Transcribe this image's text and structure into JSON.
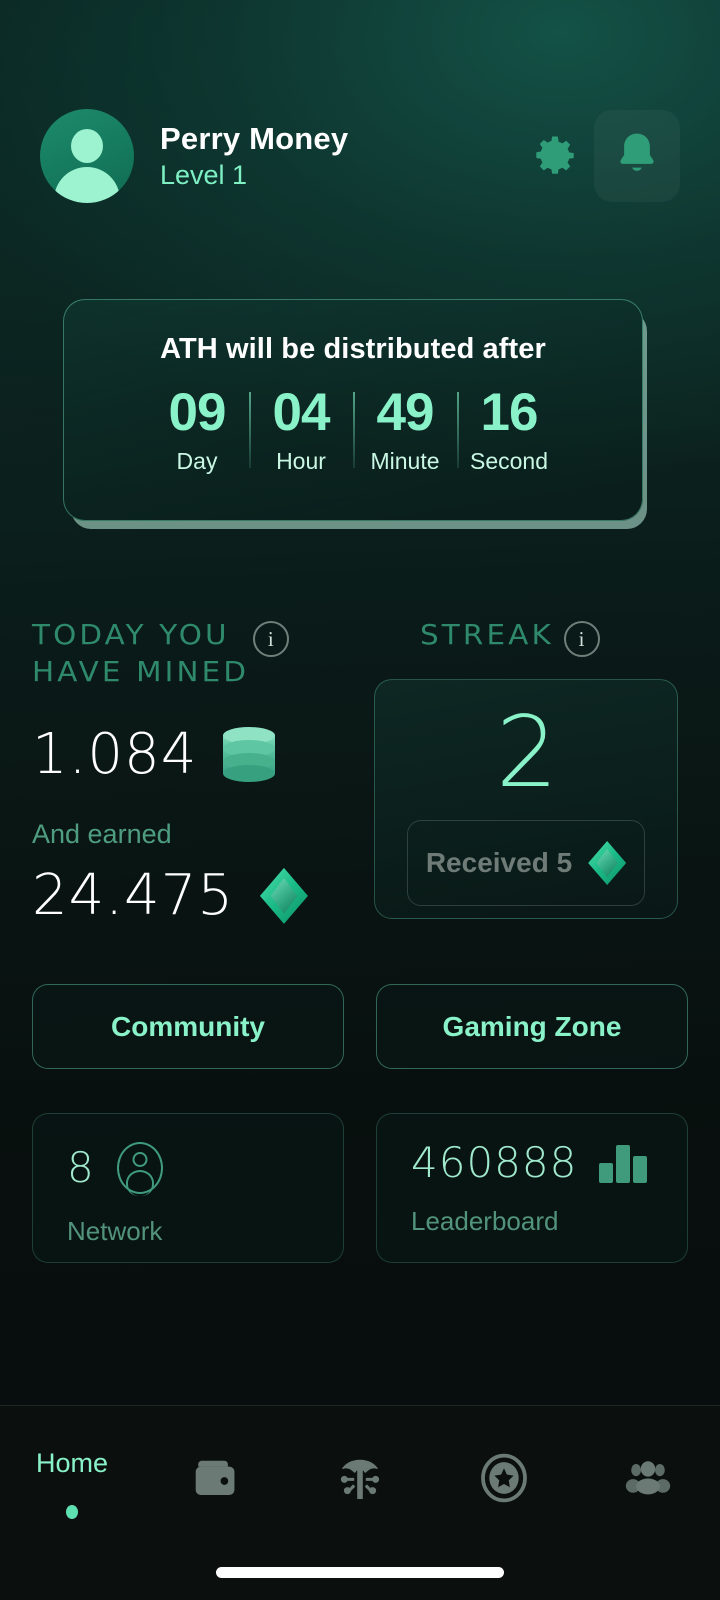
{
  "header": {
    "avatar_name": "avatar",
    "username": "Perry Money",
    "level": "Level 1",
    "gear_icon": "gear-icon",
    "bell_icon": "bell-icon"
  },
  "countdown": {
    "title": "ATH will be distributed after",
    "segments": [
      {
        "value": "09",
        "label": "Day"
      },
      {
        "value": "04",
        "label": "Hour"
      },
      {
        "value": "49",
        "label": "Minute"
      },
      {
        "value": "16",
        "label": "Second"
      }
    ]
  },
  "mined": {
    "heading_line1": "TODAY YOU",
    "heading_line2": "HAVE MINED",
    "info_icon": "i",
    "amount": "1.084",
    "coin_icon": "coin-stack-icon",
    "earned_label": "And earned",
    "earned_amount": "24.475",
    "gem_icon": "gem-icon"
  },
  "streak": {
    "heading": "STREAK",
    "info_icon": "i",
    "count": "2",
    "received_label": "Received 5",
    "gem_icon": "gem-icon"
  },
  "actions": [
    {
      "label": "Community"
    },
    {
      "label": "Gaming Zone"
    }
  ],
  "stats": [
    {
      "value": "8",
      "label": "Network",
      "icon": "person-icon"
    },
    {
      "value": "460888",
      "label": "Leaderboard",
      "icon": "bar-chart-icon"
    }
  ],
  "bottom_nav": {
    "items": [
      {
        "label": "Home",
        "icon": "home-label",
        "active": true
      },
      {
        "label": "",
        "icon": "wallet-icon",
        "active": false
      },
      {
        "label": "",
        "icon": "pickaxe-mining-icon",
        "active": false
      },
      {
        "label": "",
        "icon": "star-badge-icon",
        "active": false
      },
      {
        "label": "",
        "icon": "people-group-icon",
        "active": false
      }
    ]
  },
  "colors": {
    "accent_mint": "#8af2c8",
    "accent_green": "#2f8a6c",
    "background": "#0a1210",
    "nav_bg": "#0b100f",
    "muted_text": "#52937b",
    "inactive_icon": "#6b7a75"
  }
}
